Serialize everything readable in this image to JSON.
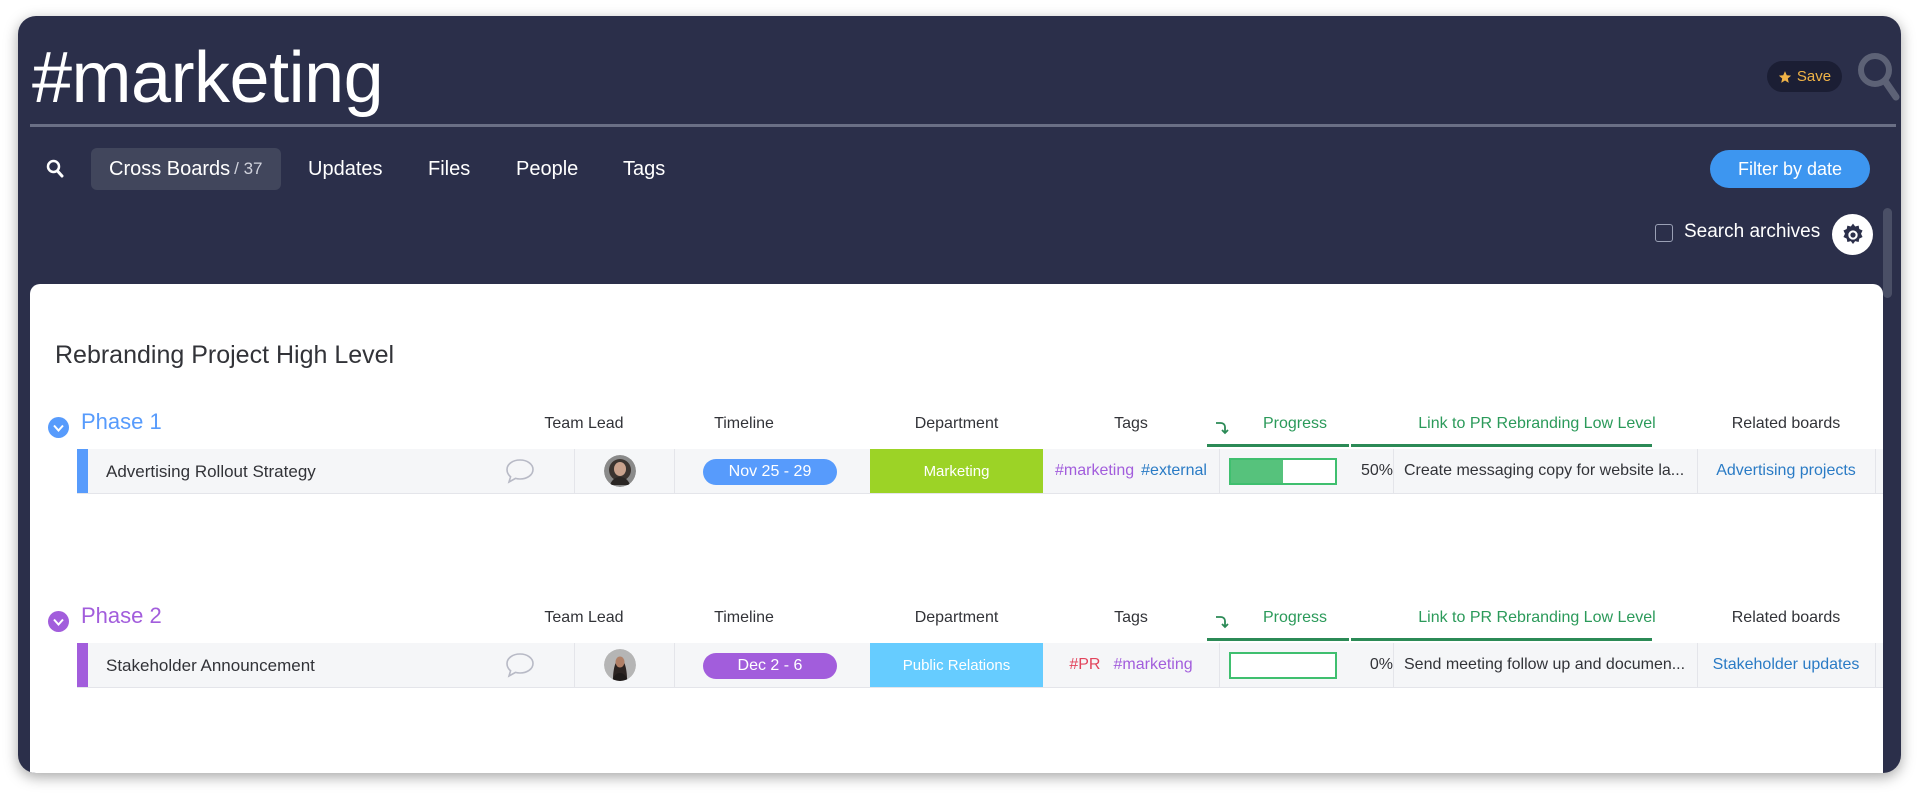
{
  "header": {
    "title": "#marketing",
    "save_label": "Save"
  },
  "tabs": [
    {
      "label": "Cross Boards",
      "count": "/ 37",
      "active": true
    },
    {
      "label": "Updates"
    },
    {
      "label": "Files"
    },
    {
      "label": "People"
    },
    {
      "label": "Tags"
    }
  ],
  "filter_label": "Filter by date",
  "archives_label": "Search archives",
  "board": {
    "title": "Rebranding Project High Level",
    "columns": {
      "team_lead": "Team Lead",
      "timeline": "Timeline",
      "department": "Department",
      "tags": "Tags",
      "progress": "Progress",
      "link": "Link to PR Rebranding Low Level",
      "related": "Related boards"
    },
    "groups": [
      {
        "name": "Phase 1",
        "color": "#579bfc",
        "item": {
          "name": "Advertising Rollout Strategy",
          "timeline": "Nov 25 - 29",
          "timeline_color": "#579bfc",
          "department": "Marketing",
          "department_color": "#9cd326",
          "tags": [
            {
              "text": "#marketing",
              "color": "#a25ddc"
            },
            {
              "text": "#external",
              "color": "#2a7bc5"
            }
          ],
          "progress": 0.5,
          "progress_label": "50%",
          "link": "Create messaging copy for website la...",
          "related": "Advertising projects"
        }
      },
      {
        "name": "Phase 2",
        "color": "#a25ddc",
        "item": {
          "name": "Stakeholder Announcement",
          "timeline": "Dec 2 - 6",
          "timeline_color": "#a25ddc",
          "department": "Public Relations",
          "department_color": "#66ccff",
          "tags": [
            {
              "text": "#PR",
              "color": "#e2445c"
            },
            {
              "text": "#marketing",
              "color": "#a25ddc"
            }
          ],
          "progress": 0,
          "progress_label": "0%",
          "link": "Send meeting follow up and documen...",
          "related": "Stakeholder updates"
        }
      }
    ]
  }
}
